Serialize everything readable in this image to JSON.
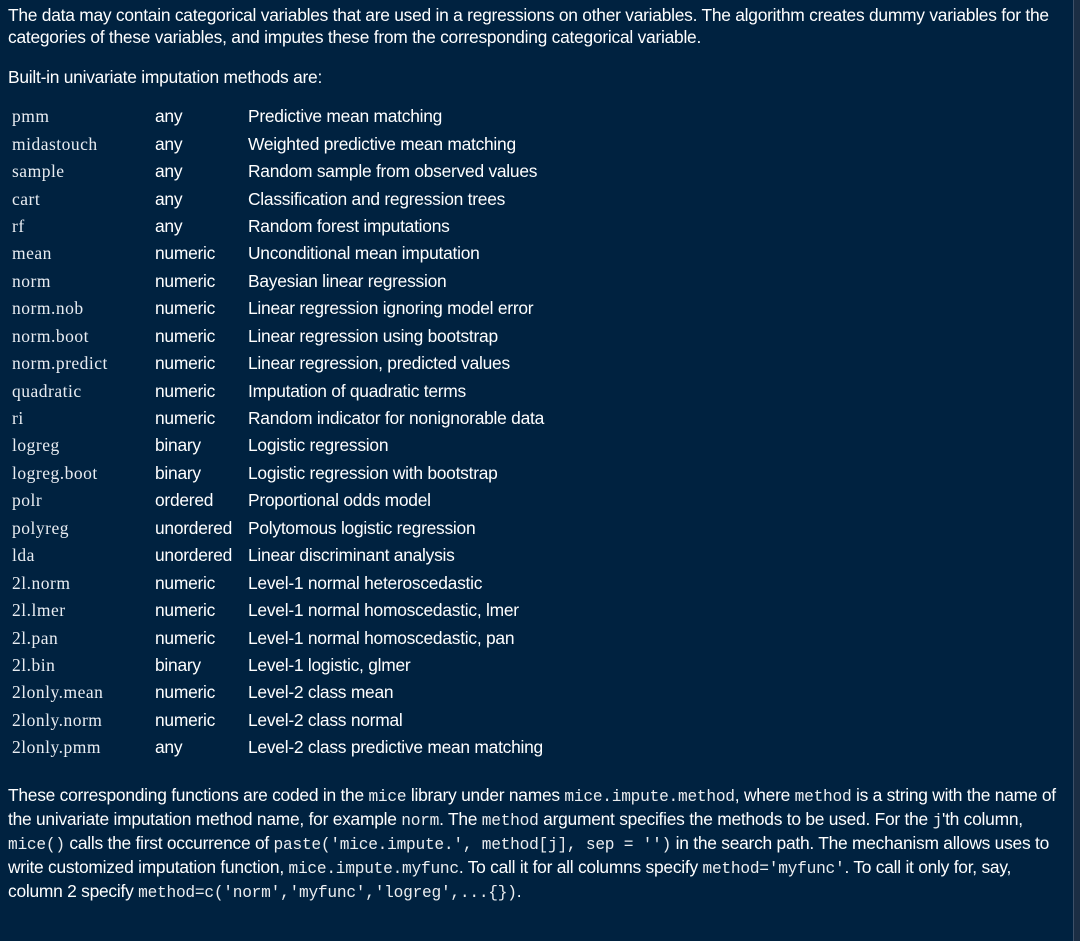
{
  "intro": {
    "text": "The data may contain categorical variables that are used in a regressions on other variables. The algorithm creates dummy variables for the categories of these variables, and imputes these from the corresponding categorical variable."
  },
  "builtin_heading": "Built-in univariate imputation methods are:",
  "methods": [
    {
      "name": "pmm",
      "type": "any",
      "description": "Predictive mean matching"
    },
    {
      "name": "midastouch",
      "type": "any",
      "description": "Weighted predictive mean matching"
    },
    {
      "name": "sample",
      "type": "any",
      "description": "Random sample from observed values"
    },
    {
      "name": "cart",
      "type": "any",
      "description": "Classification and regression trees"
    },
    {
      "name": "rf",
      "type": "any",
      "description": "Random forest imputations"
    },
    {
      "name": "mean",
      "type": "numeric",
      "description": "Unconditional mean imputation"
    },
    {
      "name": "norm",
      "type": "numeric",
      "description": "Bayesian linear regression"
    },
    {
      "name": "norm.nob",
      "type": "numeric",
      "description": "Linear regression ignoring model error"
    },
    {
      "name": "norm.boot",
      "type": "numeric",
      "description": "Linear regression using bootstrap"
    },
    {
      "name": "norm.predict",
      "type": "numeric",
      "description": "Linear regression, predicted values"
    },
    {
      "name": "quadratic",
      "type": "numeric",
      "description": "Imputation of quadratic terms"
    },
    {
      "name": "ri",
      "type": "numeric",
      "description": "Random indicator for nonignorable data"
    },
    {
      "name": "logreg",
      "type": "binary",
      "description": "Logistic regression"
    },
    {
      "name": "logreg.boot",
      "type": "binary",
      "description": "Logistic regression with bootstrap"
    },
    {
      "name": "polr",
      "type": "ordered",
      "description": "Proportional odds model"
    },
    {
      "name": "polyreg",
      "type": "unordered",
      "description": "Polytomous logistic regression"
    },
    {
      "name": "lda",
      "type": "unordered",
      "description": "Linear discriminant analysis"
    },
    {
      "name": "2l.norm",
      "type": "numeric",
      "description": "Level-1 normal heteroscedastic"
    },
    {
      "name": "2l.lmer",
      "type": "numeric",
      "description": "Level-1 normal homoscedastic, lmer"
    },
    {
      "name": "2l.pan",
      "type": "numeric",
      "description": "Level-1 normal homoscedastic, pan"
    },
    {
      "name": "2l.bin",
      "type": "binary",
      "description": "Level-1 logistic, glmer"
    },
    {
      "name": "2lonly.mean",
      "type": "numeric",
      "description": "Level-2 class mean"
    },
    {
      "name": "2lonly.norm",
      "type": "numeric",
      "description": "Level-2 class normal"
    },
    {
      "name": "2lonly.pmm",
      "type": "any",
      "description": "Level-2 class predictive mean matching"
    }
  ],
  "outro": {
    "t1": "These corresponding functions are coded in the ",
    "c1": "mice",
    "t2": " library under names ",
    "c2": "mice.impute.method",
    "t3": ", where ",
    "c3": "method",
    "t4": " is a string with the name of the univariate imputation method name, for example ",
    "c4": "norm",
    "t5": ". The ",
    "c5": "method",
    "t6": " argument specifies the methods to be used. For the ",
    "c6": "j",
    "t7": "'th column, ",
    "c7": "mice()",
    "t8": " calls the first occurrence of ",
    "c8": "paste('mice.impute.', method[j], sep = '')",
    "t9": " in the search path. The mechanism allows uses to write customized imputation function, ",
    "c9": "mice.impute.myfunc",
    "t10": ". To call it for all columns specify ",
    "c10": "method='myfunc'",
    "t11": ". To call it only for, say, column 2 specify ",
    "c11": "method=c('norm','myfunc','logreg',...{})",
    "t12": "."
  }
}
